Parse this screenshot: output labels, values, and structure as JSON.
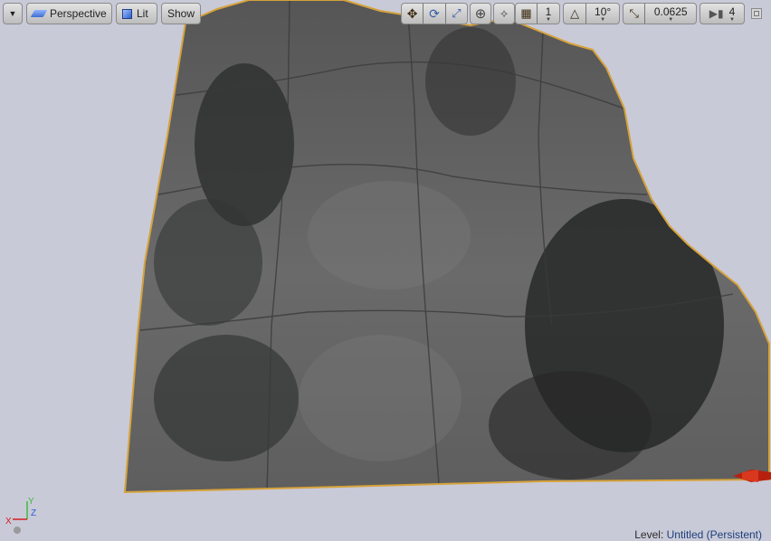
{
  "toolbar": {
    "view_mode_label": "Perspective",
    "lighting_label": "Lit",
    "show_label": "Show",
    "grid_snap_value": "1",
    "rotation_snap_value": "10°",
    "scale_snap_value": "0.0625",
    "camera_speed_value": "4"
  },
  "status": {
    "level_label": "Level:",
    "level_value": "Untitled (Persistent)"
  },
  "gizmo": {
    "x_label": "X",
    "y_label": "Y",
    "z_label": "Z"
  },
  "colors": {
    "viewport_bg": "#c9cad8",
    "terrain_outline": "#d6a23a",
    "active_tool": "#d99a3d",
    "axis_x": "#d42020",
    "axis_y": "#3dbb3d",
    "axis_z": "#2b5fd6"
  }
}
